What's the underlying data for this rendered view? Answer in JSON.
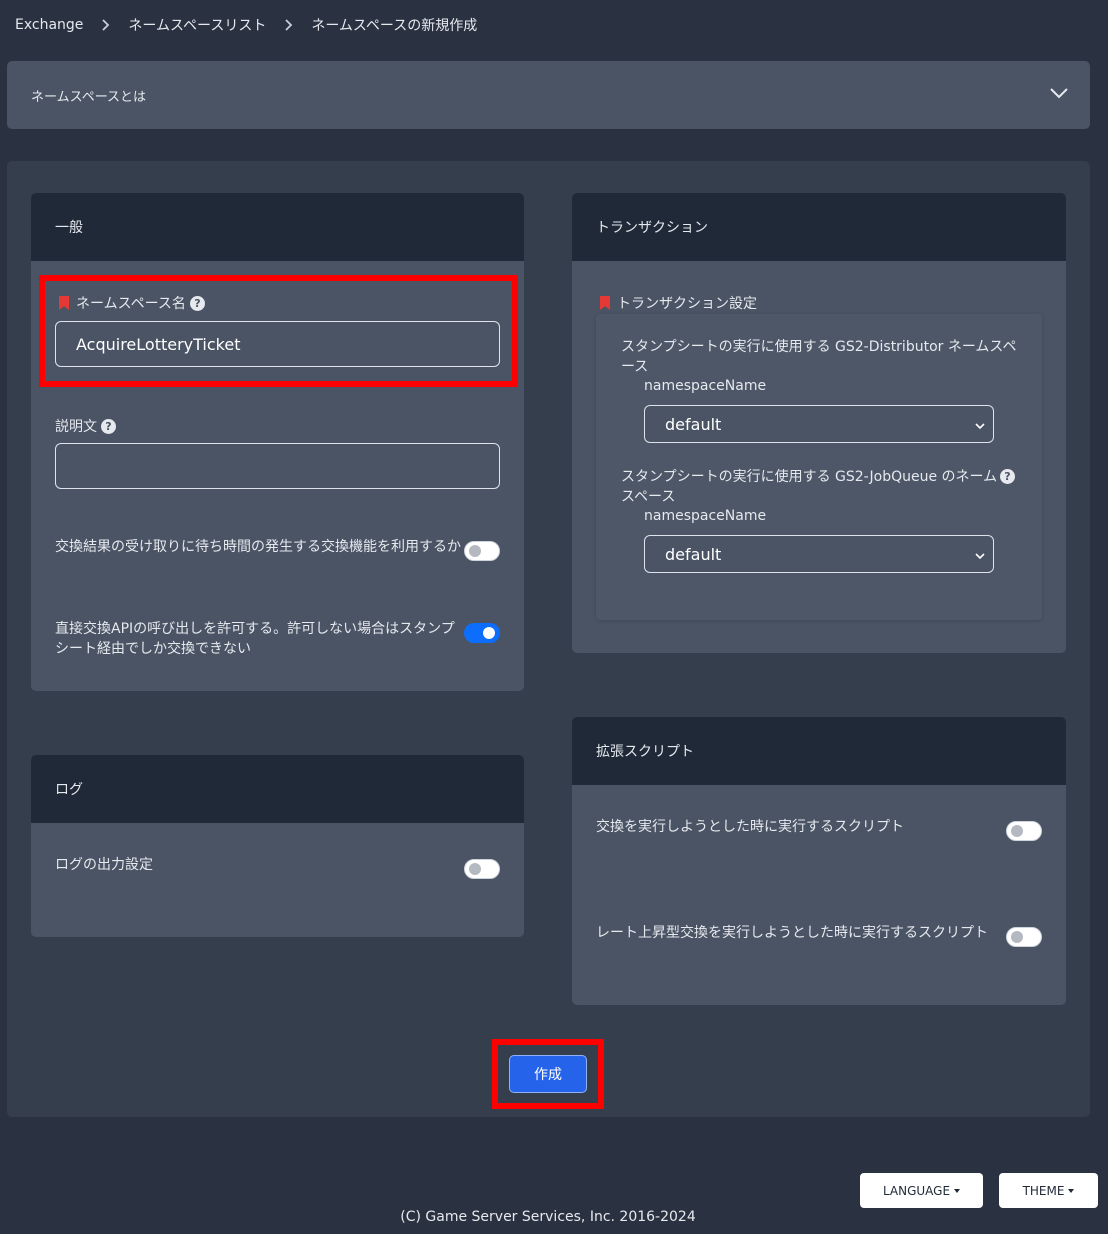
{
  "breadcrumb": {
    "items": [
      "Exchange",
      "ネームスペースリスト",
      "ネームスペースの新規作成"
    ]
  },
  "accordion": {
    "title": "ネームスペースとは"
  },
  "general": {
    "header": "一般",
    "name_label": "ネームスペース名",
    "name_value": "AcquireLotteryTicket",
    "description_label": "説明文",
    "description_value": "",
    "await_toggle_label": "交換結果の受け取りに待ち時間の発生する交換機能を利用するか",
    "await_toggle_on": false,
    "direct_toggle_label_line1": "直接交換APIの呼び出しを許可する。許可しない場合はスタンプ",
    "direct_toggle_label_line2": "シート経由でしか交換できない",
    "direct_toggle_on": true
  },
  "log": {
    "header": "ログ",
    "log_setting_label": "ログの出力設定",
    "log_setting_on": false
  },
  "transaction": {
    "header": "トランザクション",
    "section_label": "トランザクション設定",
    "distributor_label_line1": "スタンプシートの実行に使用する GS2-Distributor ネームスペ",
    "distributor_label_line2": "ース",
    "distributor_sub_label": "namespaceName",
    "distributor_value": "default",
    "jobqueue_label_line1": "スタンプシートの実行に使用する GS2-JobQueue のネーム",
    "jobqueue_label_line2": "スペース",
    "jobqueue_sub_label": "namespaceName",
    "jobqueue_value": "default"
  },
  "script": {
    "header": "拡張スクリプト",
    "exchange_script_label": "交換を実行しようとした時に実行するスクリプト",
    "exchange_script_on": false,
    "rate_script_label": "レート上昇型交換を実行しようとした時に実行するスクリプト",
    "rate_script_on": false
  },
  "actions": {
    "create_label": "作成"
  },
  "footer": {
    "language_label": "LANGUAGE",
    "theme_label": "THEME",
    "copyright": "(C) Game Server Services, Inc. 2016-2024"
  },
  "colors": {
    "highlight": "#ff0000",
    "primary": "#2563eb",
    "toggle_on": "#0d6efd",
    "required_marker": "#e53935"
  }
}
